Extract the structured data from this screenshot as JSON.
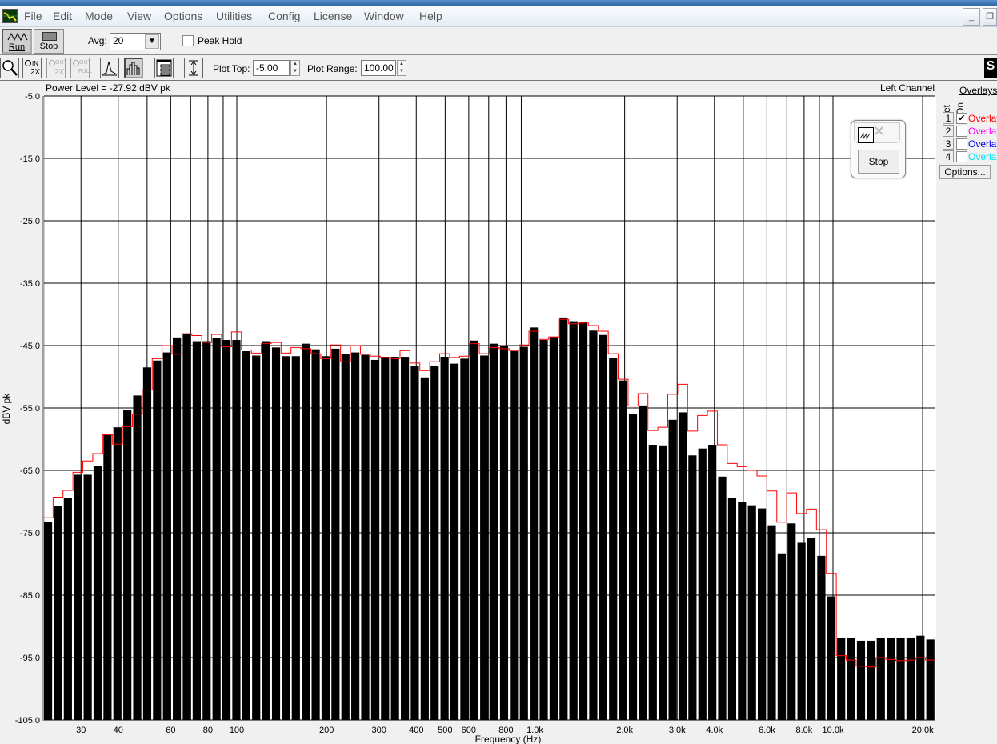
{
  "menu": {
    "items": [
      "File",
      "Edit",
      "Mode",
      "View",
      "Options",
      "Utilities",
      "Config",
      "License",
      "Window",
      "Help"
    ]
  },
  "window_controls": {
    "minimize": "_",
    "restore": "❐"
  },
  "toolbar1": {
    "run_label": "Run",
    "stop_label": "Stop",
    "avg_label": "Avg:",
    "avg_value": "20",
    "peak_hold_label": "Peak Hold",
    "peak_hold_checked": false
  },
  "toolbar2": {
    "zoom_in_label": "IN",
    "zoom_in_factor": "2X",
    "zoom_out_label": "OUT",
    "zoom_out_factor": "2X",
    "zoom_full_label": "OUT",
    "zoom_full_factor": "FULL",
    "plot_top_label": "Plot Top:",
    "plot_top_value": "-5.00",
    "plot_range_label": "Plot Range:",
    "plot_range_value": "100.00",
    "right_icon_glyph": "S"
  },
  "plot_header": {
    "power_level": "Power Level = -27.92 dBV pk",
    "channel": "Left Channel"
  },
  "overlays": {
    "title": "Overlays",
    "set_label": "Set",
    "on_label": "On",
    "options_label": "Options...",
    "items": [
      {
        "num": "1",
        "label": "Overlay",
        "checked": true,
        "color": "#ff0000"
      },
      {
        "num": "2",
        "label": "Overlay",
        "checked": false,
        "color": "#ff00ff"
      },
      {
        "num": "3",
        "label": "Overlay",
        "checked": false,
        "color": "#0000ff"
      },
      {
        "num": "4",
        "label": "Overlay",
        "checked": false,
        "color": "#00e0ff"
      }
    ]
  },
  "mini_window": {
    "stop_label": "Stop"
  },
  "chart_data": {
    "type": "bar",
    "xlabel": "Frequency (Hz)",
    "ylabel": "dBV pk",
    "x_scale": "log",
    "xlim": [
      22.4,
      22000
    ],
    "ylim": [
      -105,
      -5
    ],
    "grid": true,
    "yticks": [
      "-5.0",
      "-15.0",
      "-25.0",
      "-35.0",
      "-45.0",
      "-55.0",
      "-65.0",
      "-75.0",
      "-85.0",
      "-95.0",
      "-105.0"
    ],
    "xticks": [
      {
        "f": 30,
        "label": "30"
      },
      {
        "f": 40,
        "label": "40"
      },
      {
        "f": 60,
        "label": "60"
      },
      {
        "f": 80,
        "label": "80"
      },
      {
        "f": 100,
        "label": "100"
      },
      {
        "f": 200,
        "label": "200"
      },
      {
        "f": 300,
        "label": "300"
      },
      {
        "f": 400,
        "label": "400"
      },
      {
        "f": 500,
        "label": "500"
      },
      {
        "f": 600,
        "label": "600"
      },
      {
        "f": 800,
        "label": "800"
      },
      {
        "f": 1000,
        "label": "1.0k"
      },
      {
        "f": 2000,
        "label": "2.0k"
      },
      {
        "f": 3000,
        "label": "3.0k"
      },
      {
        "f": 4000,
        "label": "4.0k"
      },
      {
        "f": 6000,
        "label": "6.0k"
      },
      {
        "f": 8000,
        "label": "8.0k"
      },
      {
        "f": 10000,
        "label": "10.0k"
      },
      {
        "f": 20000,
        "label": "20.0k"
      }
    ],
    "series": [
      {
        "color": "#000000",
        "values": [
          -73.3,
          -70.7,
          -69.4,
          -65.7,
          -65.7,
          -64.3,
          -59.3,
          -58.1,
          -55.3,
          -53.0,
          -48.5,
          -47.4,
          -46.1,
          -43.7,
          -43.1,
          -44.3,
          -44.3,
          -43.8,
          -44.1,
          -44.1,
          -45.9,
          -46.6,
          -44.3,
          -45.3,
          -46.7,
          -46.7,
          -44.7,
          -45.6,
          -46.7,
          -45.5,
          -46.4,
          -46.1,
          -46.5,
          -47.3,
          -46.8,
          -46.8,
          -46.8,
          -48.2,
          -50.1,
          -48.2,
          -46.8,
          -47.9,
          -47.1,
          -44.2,
          -46.6,
          -44.7,
          -45.0,
          -45.9,
          -45.2,
          -42.1,
          -44.1,
          -43.6,
          -40.5,
          -41.1,
          -41.2,
          -42.6,
          -43.3,
          -47.0,
          -50.6,
          -56.0,
          -54.6,
          -60.9,
          -61.0,
          -56.9,
          -55.7,
          -62.6,
          -61.5,
          -60.9,
          -66.0,
          -69.4,
          -70.0,
          -70.6,
          -71.1,
          -73.8,
          -78.3,
          -73.5,
          -76.6,
          -75.9,
          -78.7,
          -85.2,
          -91.8,
          -91.9,
          -92.3,
          -92.3,
          -91.9,
          -91.8,
          -91.9,
          -91.8,
          -91.5,
          -92.1
        ]
      },
      {
        "color": "#ff0000",
        "values": [
          -72.6,
          -69.3,
          -68.2,
          -65.3,
          -63.5,
          -62.3,
          -59.3,
          -60.8,
          -58.0,
          -56.0,
          -52.1,
          -47.1,
          -45.0,
          -46.4,
          -43.1,
          -43.4,
          -44.5,
          -43.2,
          -45.2,
          -42.8,
          -45.7,
          -46.2,
          -44.7,
          -44.5,
          -46.2,
          -45.3,
          -45.5,
          -46.3,
          -47.1,
          -44.9,
          -47.6,
          -45.0,
          -46.4,
          -46.7,
          -46.9,
          -47.1,
          -45.8,
          -47.8,
          -49.0,
          -47.6,
          -46.3,
          -46.9,
          -46.7,
          -44.7,
          -46.3,
          -45.3,
          -45.5,
          -45.8,
          -44.9,
          -42.7,
          -44.0,
          -43.6,
          -40.8,
          -41.5,
          -41.4,
          -41.8,
          -42.7,
          -46.3,
          -50.4,
          -54.7,
          -52.7,
          -58.6,
          -58.1,
          -52.8,
          -51.2,
          -58.7,
          -56.2,
          -55.5,
          -60.9,
          -63.9,
          -64.4,
          -65.0,
          -65.9,
          -68.3,
          -73.3,
          -68.6,
          -71.9,
          -71.2,
          -74.5,
          -81.5,
          -94.7,
          -95.4,
          -96.4,
          -96.5,
          -95.0,
          -95.3,
          -95.5,
          -95.4,
          -95.0,
          -95.4
        ]
      }
    ]
  }
}
